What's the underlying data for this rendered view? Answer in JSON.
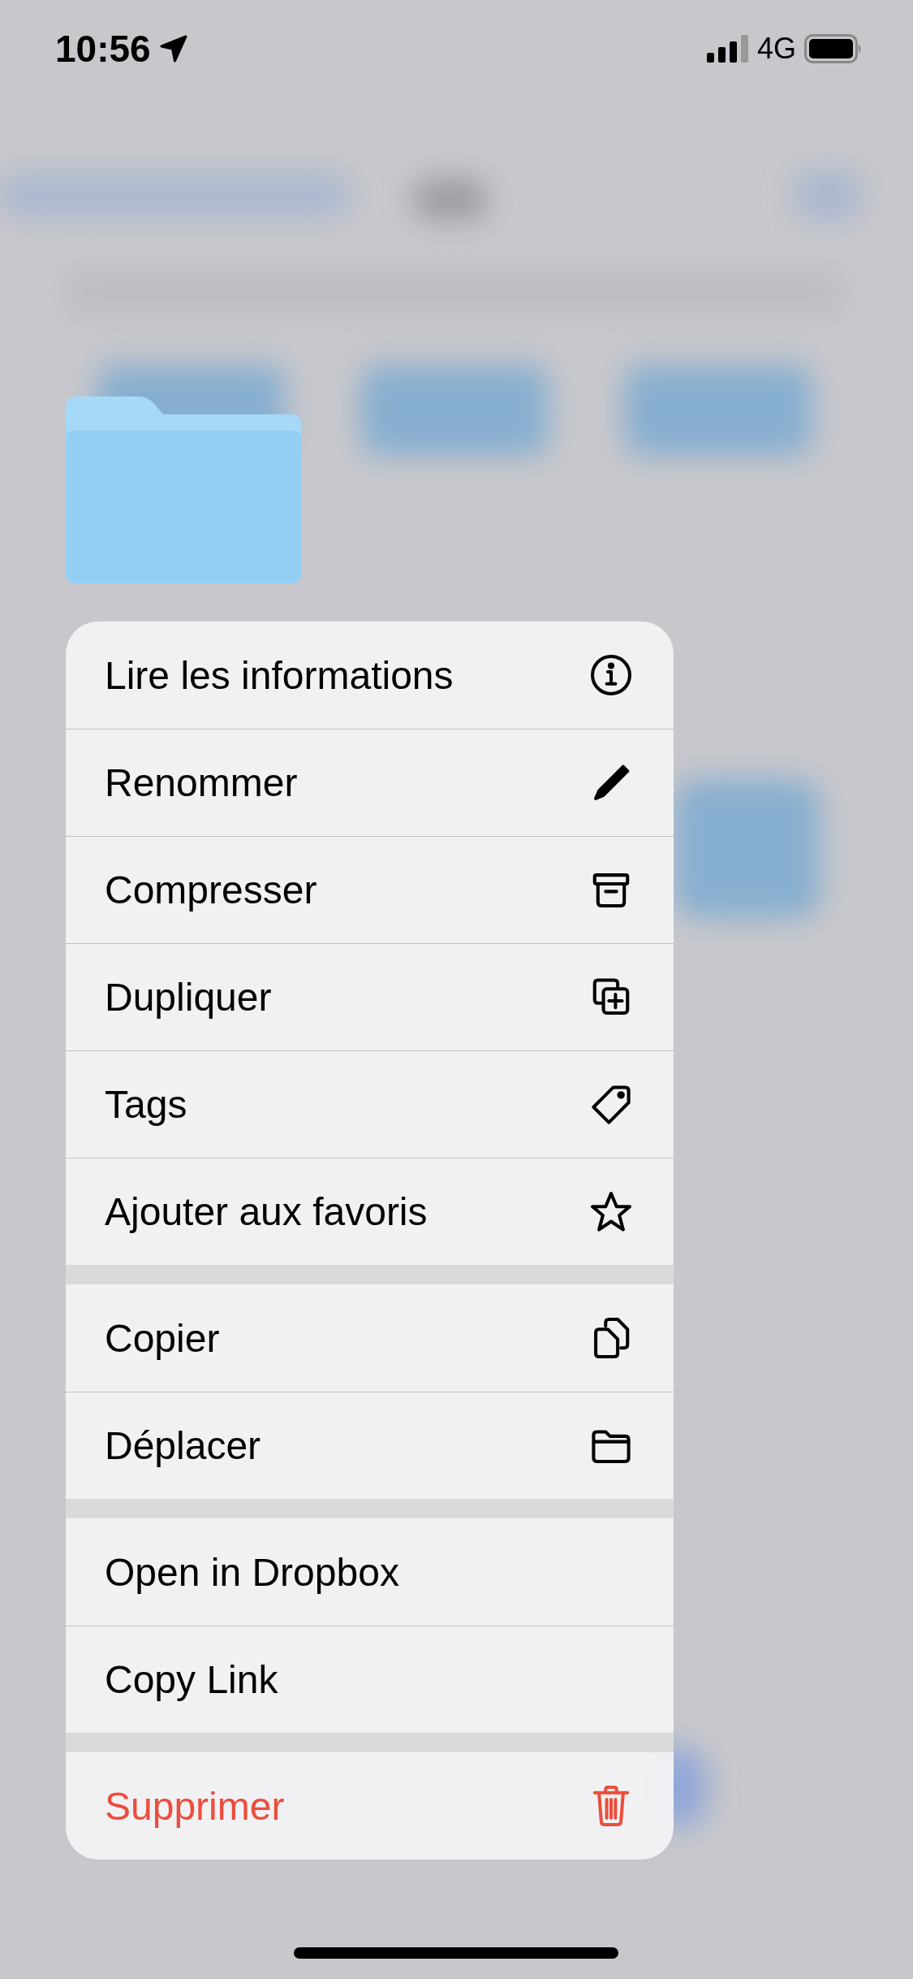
{
  "status_bar": {
    "time": "10:56",
    "network": "4G"
  },
  "menu": {
    "groups": [
      {
        "items": [
          {
            "label": "Lire les informations",
            "destructive": false
          },
          {
            "label": "Renommer",
            "destructive": false
          },
          {
            "label": "Compresser",
            "destructive": false
          },
          {
            "label": "Dupliquer",
            "destructive": false
          },
          {
            "label": "Tags",
            "destructive": false
          },
          {
            "label": "Ajouter aux favoris",
            "destructive": false
          }
        ]
      },
      {
        "items": [
          {
            "label": "Copier",
            "destructive": false
          },
          {
            "label": "Déplacer",
            "destructive": false
          }
        ]
      },
      {
        "items": [
          {
            "label": "Open in Dropbox",
            "destructive": false
          },
          {
            "label": "Copy Link",
            "destructive": false
          }
        ]
      },
      {
        "items": [
          {
            "label": "Supprimer",
            "destructive": true
          }
        ]
      }
    ]
  }
}
